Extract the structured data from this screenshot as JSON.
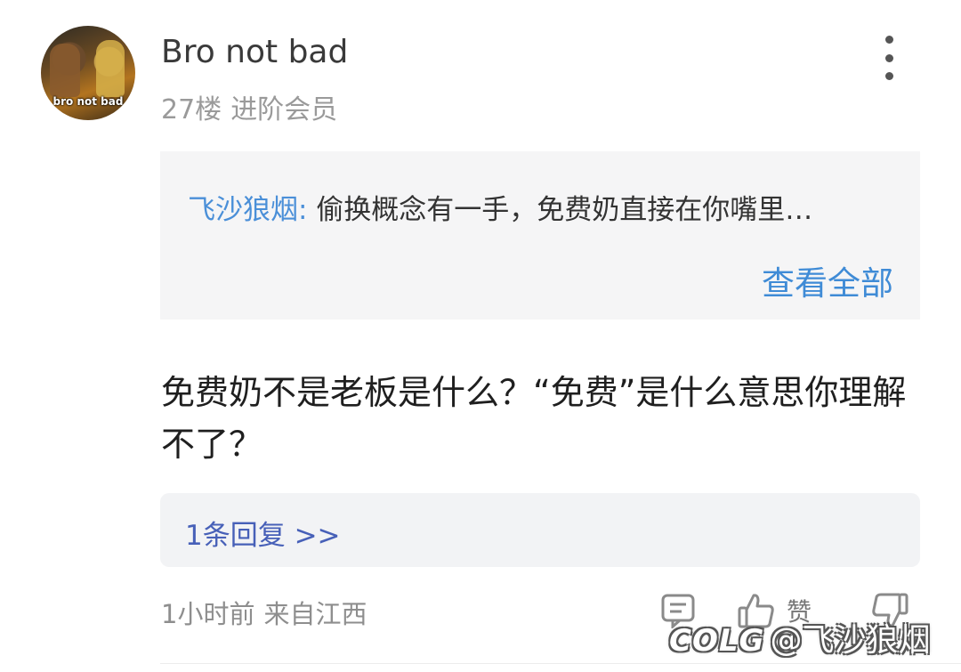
{
  "post": {
    "avatar_caption": "bro not bad",
    "username": "Bro not bad",
    "floor": "27楼",
    "member_level": "进阶会员",
    "quote": {
      "author": "飞沙狼烟:",
      "text": "偷换概念有一手，免费奶直接在你嘴里…",
      "view_all": "查看全部"
    },
    "content": "免费奶不是老板是什么？“免费”是什么意思你理解不了？",
    "replies_label": "1条回复 >>",
    "time": "1小时前",
    "location": "来自江西",
    "like_label": "赞"
  },
  "watermark": {
    "brand": "COLG",
    "handle": "@飞沙狼烟"
  },
  "icons": [
    "more-vertical-icon",
    "comment-icon",
    "thumbs-up-icon",
    "thumbs-down-icon"
  ],
  "colors": {
    "link_blue": "#3f8bd6",
    "reply_blue": "#4760b8",
    "quote_bg": "#f5f5f6"
  }
}
